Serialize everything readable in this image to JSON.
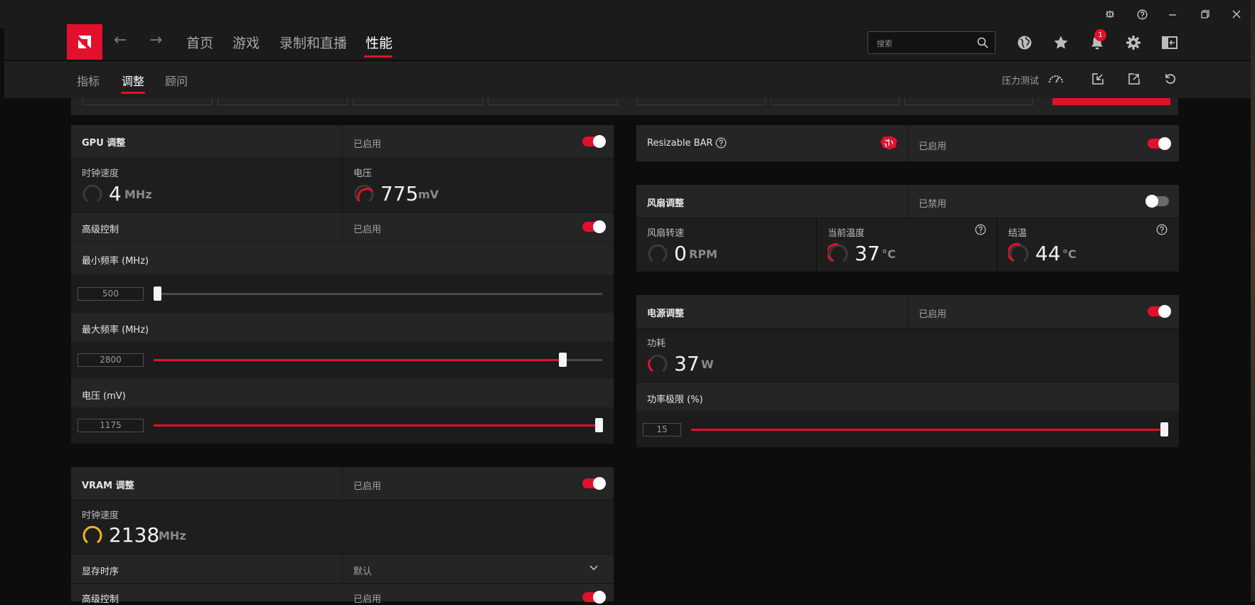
{
  "nav": {
    "tabs": [
      "首页",
      "游戏",
      "录制和直播",
      "性能"
    ],
    "active_tab": "性能",
    "search_placeholder": "搜索",
    "notification_count": "1"
  },
  "subnav": {
    "tabs": [
      "指标",
      "调整",
      "顾问"
    ],
    "active_tab": "调整",
    "stress_test_label": "压力测试"
  },
  "colors": {
    "accent": "#e1112d",
    "vram_gauge": "#f0b429",
    "panel": "#252525",
    "background": "#0d0d0d"
  },
  "gpu": {
    "title": "GPU 调整",
    "status": "已启用",
    "enabled": true,
    "clock_label": "时钟速度",
    "clock_value": "4",
    "clock_unit": "MHz",
    "voltage_label": "电压",
    "voltage_value": "775",
    "voltage_unit": "mV",
    "advanced_label": "高级控制",
    "advanced_status": "已启用",
    "advanced_enabled": true,
    "sliders": [
      {
        "label": "最小频率 (MHz)",
        "value": "500",
        "fraction": 0.0
      },
      {
        "label": "最大频率 (MHz)",
        "value": "2800",
        "fraction": 0.91
      },
      {
        "label": "电压 (mV)",
        "value": "1175",
        "fraction": 1.0
      }
    ]
  },
  "vram": {
    "title": "VRAM 调整",
    "status": "已启用",
    "enabled": true,
    "clock_label": "时钟速度",
    "clock_value": "2138",
    "clock_unit": "MHz",
    "timing_label": "显存时序",
    "timing_value": "默认",
    "advanced_label": "高级控制",
    "advanced_status": "已启用",
    "advanced_enabled": true
  },
  "resizable_bar": {
    "label": "Resizable BAR",
    "status": "已启用",
    "enabled": true
  },
  "fan": {
    "title": "风扇调整",
    "status": "已禁用",
    "enabled": false,
    "speed_label": "风扇转速",
    "speed_value": "0",
    "speed_unit": "RPM",
    "temp_label": "当前温度",
    "temp_value": "37",
    "temp_unit": "°C",
    "junction_label": "结温",
    "junction_value": "44",
    "junction_unit": "°C"
  },
  "power": {
    "title": "电源调整",
    "status": "已启用",
    "enabled": true,
    "draw_label": "功耗",
    "draw_value": "37",
    "draw_unit": "W",
    "limit_label": "功率极限 (%)",
    "limit_value": "15",
    "limit_fraction": 1.0
  },
  "icons": {
    "window": [
      "bug-icon",
      "help-icon",
      "minimize-icon",
      "restore-icon",
      "close-icon"
    ],
    "toolbar": [
      "globe-icon",
      "star-icon",
      "bell-icon",
      "gear-icon",
      "sidebar-icon"
    ],
    "subnav": [
      "gauge-icon",
      "import-icon",
      "export-icon",
      "reset-icon"
    ]
  }
}
